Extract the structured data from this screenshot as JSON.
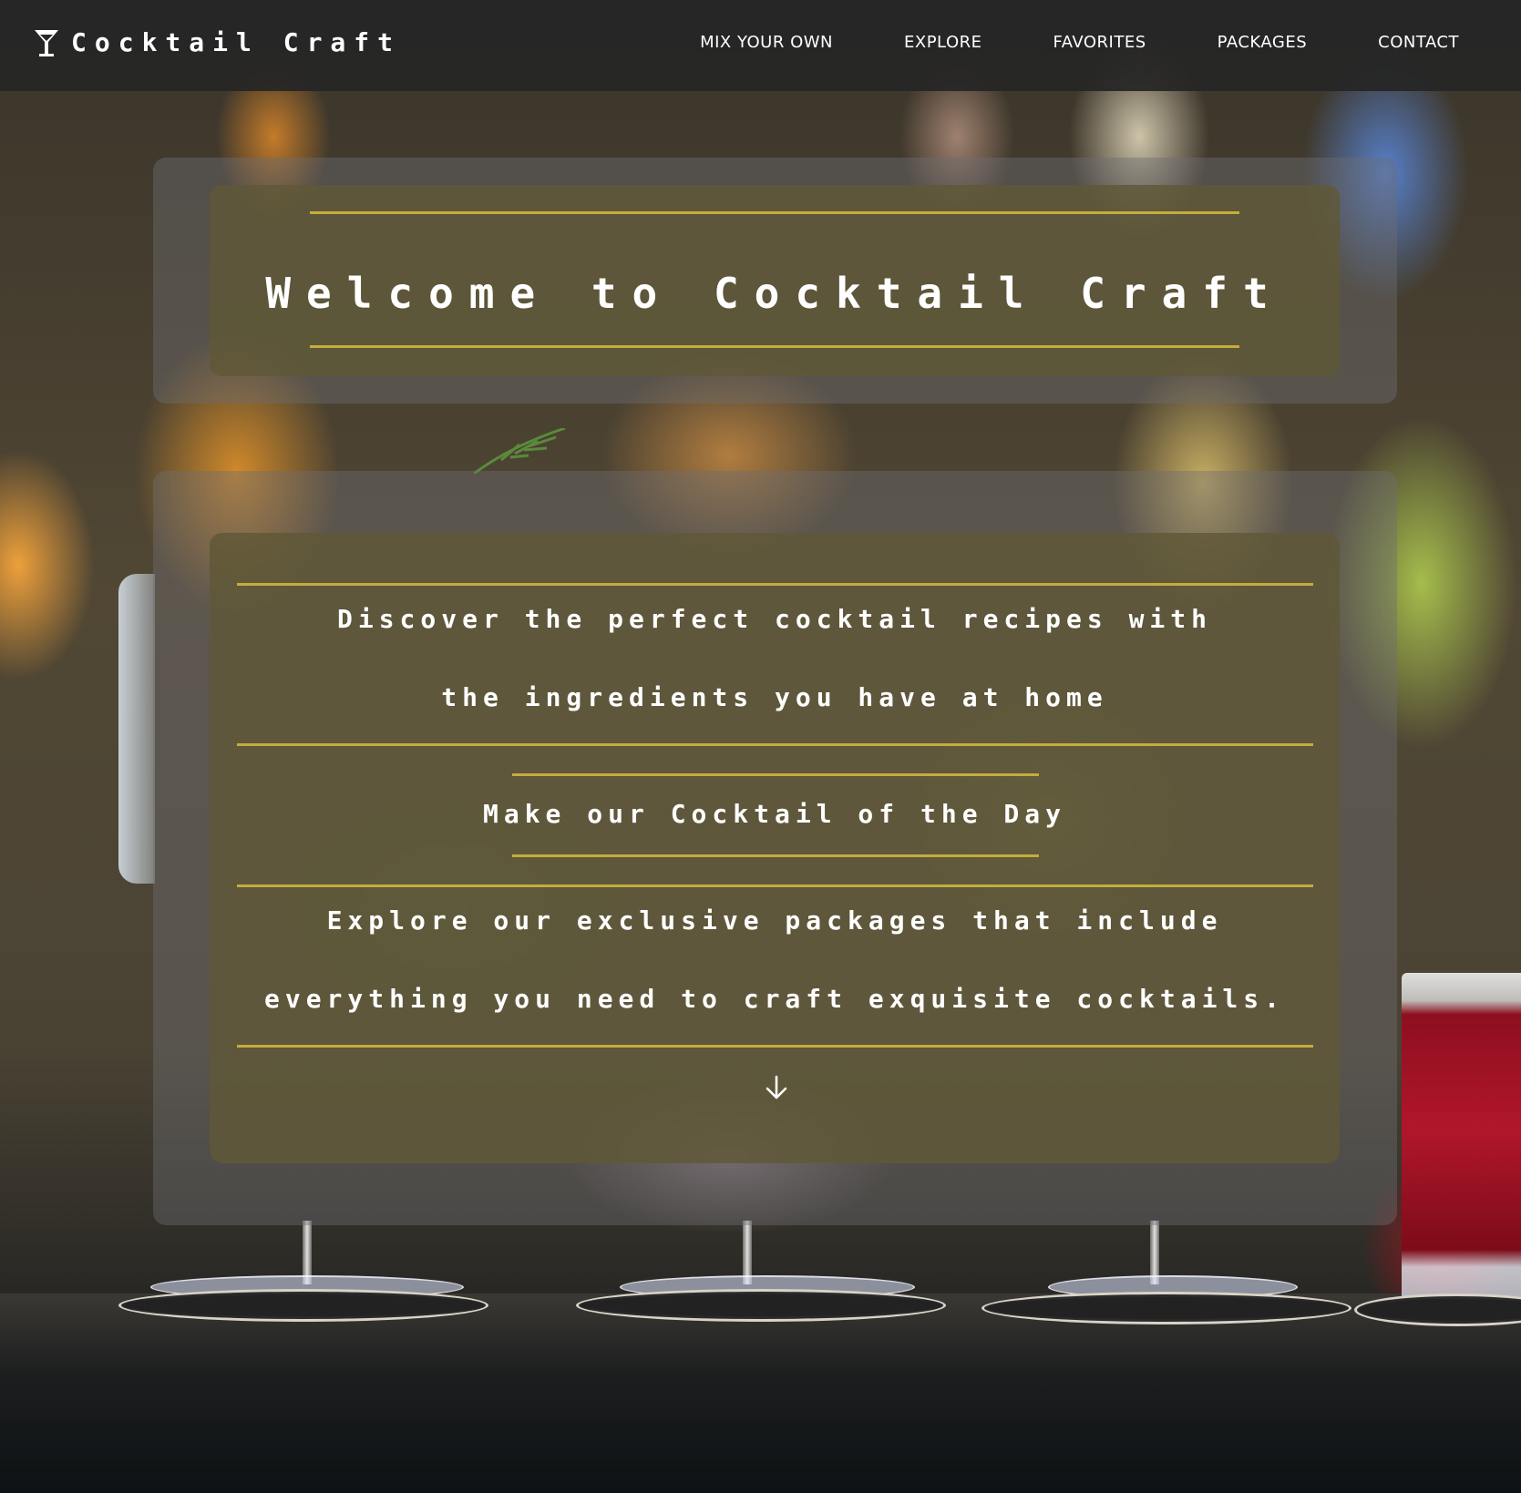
{
  "header": {
    "brand": "Cocktail Craft",
    "brand_icon": "cocktail-glass-icon",
    "nav": [
      "MIX YOUR OWN",
      "EXPLORE",
      "FAVORITES",
      "PACKAGES",
      "CONTACT"
    ]
  },
  "hero": {
    "title": "Welcome to Cocktail Craft"
  },
  "intro": {
    "discover": "Discover the perfect cocktail recipes with the ingredients you have at home",
    "cocktail_of_day_link": "Make our Cocktail of the Day",
    "packages": "Explore our exclusive packages that include everything you need to craft exquisite cocktails.",
    "scroll_icon": "arrow-down-icon"
  },
  "colors": {
    "accent_gold": "#c4ad3b",
    "nav_bg": "#262626",
    "text": "#ffffff"
  }
}
